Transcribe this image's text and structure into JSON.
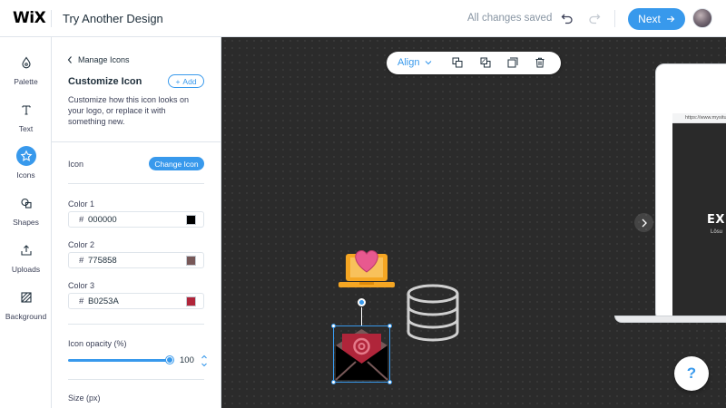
{
  "header": {
    "logo": "WiX",
    "site_name": "Try Another Design",
    "save_status": "All changes saved",
    "next_label": "Next"
  },
  "rail": {
    "items": [
      {
        "label": "Palette",
        "icon": "drop-icon"
      },
      {
        "label": "Text",
        "icon": "text-icon"
      },
      {
        "label": "Icons",
        "icon": "star-icon",
        "active": true
      },
      {
        "label": "Shapes",
        "icon": "shapes-icon"
      },
      {
        "label": "Uploads",
        "icon": "upload-icon"
      },
      {
        "label": "Background",
        "icon": "background-icon"
      }
    ]
  },
  "panel": {
    "back_label": "Manage Icons",
    "title": "Customize Icon",
    "add_label": "Add",
    "description": "Customize how this icon looks on your logo, or replace it with something new.",
    "icon_label": "Icon",
    "change_icon_label": "Change Icon",
    "colors": [
      {
        "label": "Color 1",
        "hex": "000000",
        "swatch": "#000000"
      },
      {
        "label": "Color 2",
        "hex": "775858",
        "swatch": "#775858"
      },
      {
        "label": "Color 3",
        "hex": "B0253A",
        "swatch": "#B0253A"
      }
    ],
    "opacity_label": "Icon opacity (%)",
    "opacity_value": "100",
    "opacity_level": 1.0,
    "size_label": "Size (px)"
  },
  "toolbar": {
    "align_label": "Align",
    "icons": [
      "arrange-forward-icon",
      "arrange-backward-icon",
      "duplicate-icon",
      "delete-icon"
    ]
  },
  "preview": {
    "url": "https://www.mysitu",
    "brand": "EX",
    "sub": "Lösu"
  },
  "help_label": "?",
  "colors": {
    "accent": "#3899ec",
    "canvas": "#2b2b2b",
    "icon_orange": "#f5a623",
    "icon_pink": "#e8598f",
    "icon_red": "#B0253A"
  }
}
